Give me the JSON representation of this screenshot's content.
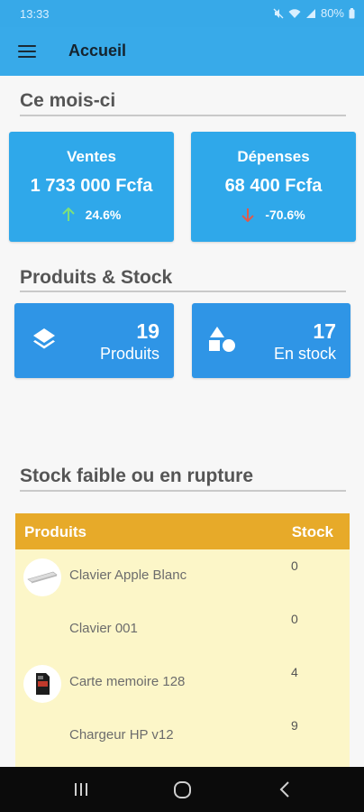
{
  "status_bar": {
    "time": "13:33",
    "battery": "80%"
  },
  "app_bar": {
    "title": "Accueil"
  },
  "month_section": {
    "title": "Ce mois-ci",
    "sales": {
      "label": "Ventes",
      "value": "1 733 000 Fcfa",
      "trend": "24.6%",
      "trend_direction": "up",
      "trend_color": "#7ee07a"
    },
    "expenses": {
      "label": "Dépenses",
      "value": "68 400 Fcfa",
      "trend": "-70.6%",
      "trend_direction": "down",
      "trend_color": "#e05a4b"
    }
  },
  "products_section": {
    "title": "Produits & Stock",
    "products": {
      "count": "19",
      "label": "Produits",
      "icon": "layers-icon"
    },
    "in_stock": {
      "count": "17",
      "label": "En stock",
      "icon": "shapes-icon"
    }
  },
  "low_stock_section": {
    "title": "Stock faible ou en rupture",
    "columns": {
      "product": "Produits",
      "stock": "Stock"
    },
    "rows": [
      {
        "name": "Clavier Apple Blanc",
        "stock": "0",
        "thumb": "keyboard"
      },
      {
        "name": "Clavier 001",
        "stock": "0",
        "thumb": ""
      },
      {
        "name": "Carte memoire 128",
        "stock": "4",
        "thumb": "sd-card"
      },
      {
        "name": "Chargeur HP v12",
        "stock": "9",
        "thumb": ""
      }
    ]
  },
  "colors": {
    "primary": "#38aae9",
    "card": "#2fa8ea",
    "table_header": "#e7aa29",
    "table_bg": "#fcf6c8"
  }
}
